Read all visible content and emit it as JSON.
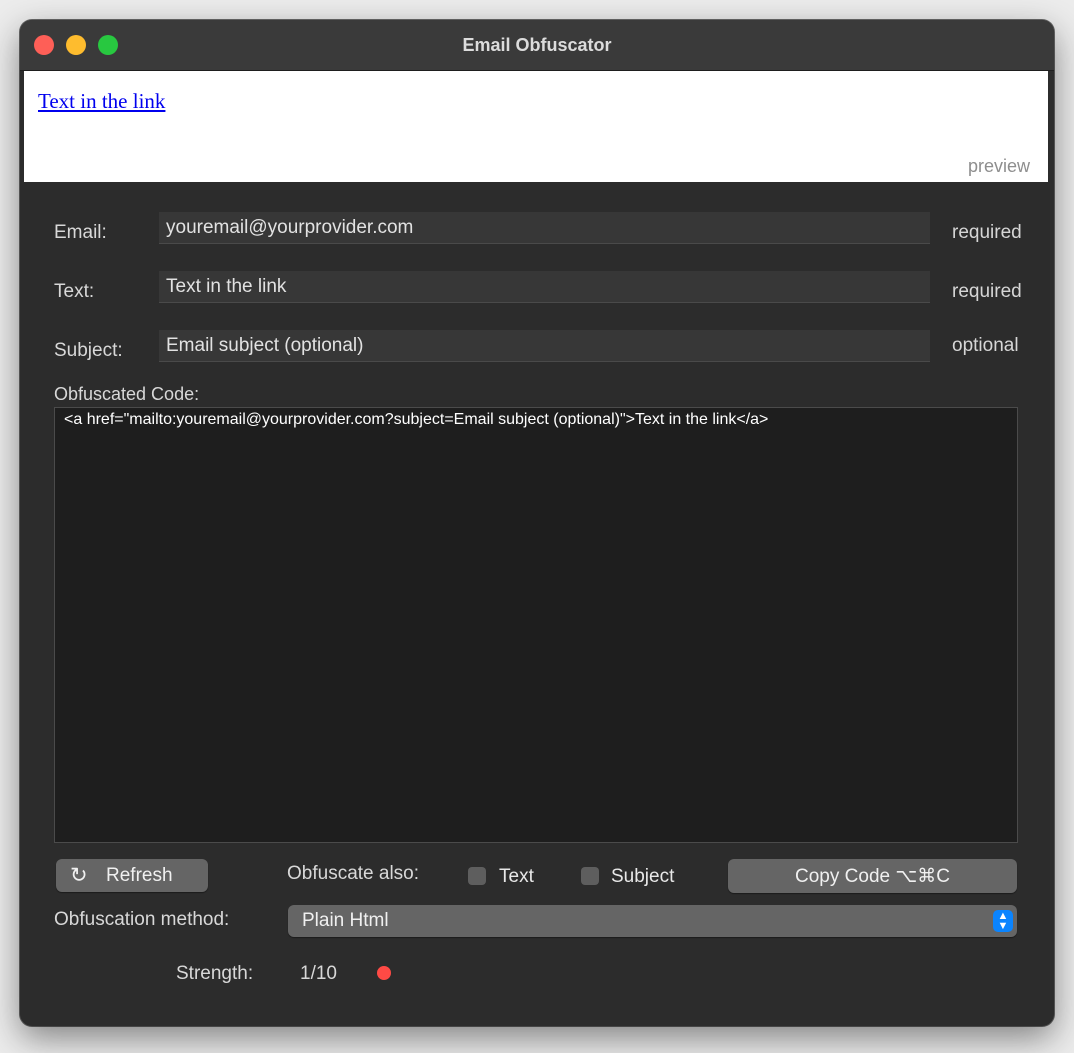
{
  "window": {
    "title": "Email Obfuscator"
  },
  "preview": {
    "link_text": "Text in the link",
    "tag": "preview"
  },
  "form": {
    "email": {
      "label": "Email:",
      "value": "youremail@yourprovider.com",
      "hint": "required"
    },
    "text": {
      "label": "Text:",
      "value": "Text in the link",
      "hint": "required"
    },
    "subject": {
      "label": "Subject:",
      "value": "Email subject (optional)",
      "hint": "optional"
    }
  },
  "code": {
    "label": "Obfuscated Code:",
    "value": "<a href=\"mailto:youremail@yourprovider.com?subject=Email subject (optional)\">Text in the link</a>"
  },
  "controls": {
    "refresh_icon": "↻",
    "refresh_label": "Refresh",
    "obfuscate_also_label": "Obfuscate also:",
    "checkbox_text_label": "Text",
    "checkbox_subject_label": "Subject",
    "copy_label": "Copy Code ⌥⌘C",
    "method_label": "Obfuscation method:",
    "method_value": "Plain Html",
    "strength_label": "Strength:",
    "strength_value": "1/10"
  },
  "colors": {
    "close": "#fe5f57",
    "minimize": "#febc2e",
    "maximize": "#28c840",
    "accent": "#0a84ff",
    "strength_indicator": "#fe4a45"
  },
  "icons": {
    "refresh": "refresh-icon",
    "select_arrows": "chevron-up-down-icon",
    "strength": "status-dot-icon"
  }
}
